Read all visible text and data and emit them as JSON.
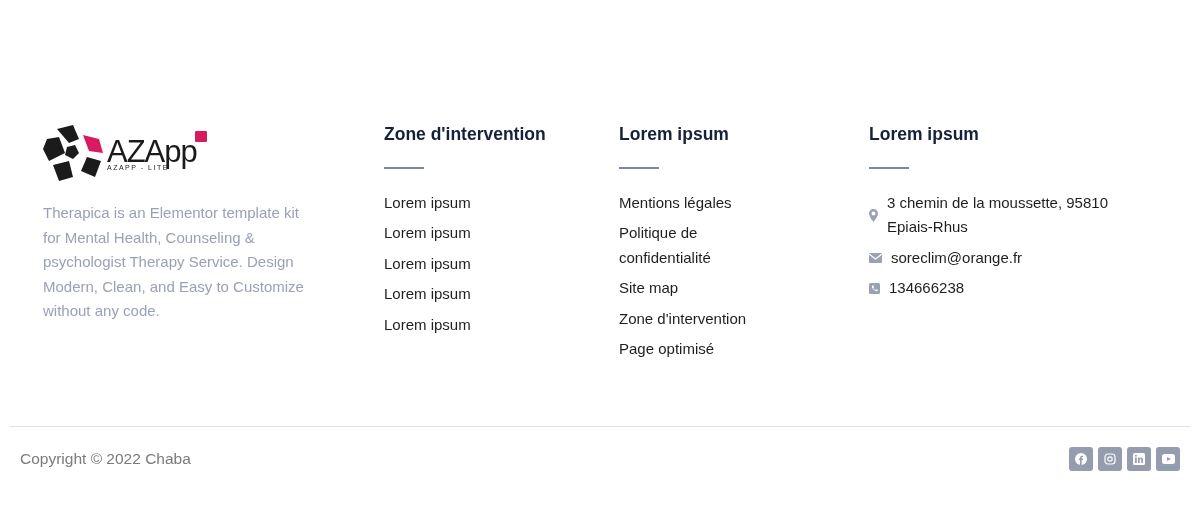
{
  "brand": {
    "logo_text": "AZApp",
    "logo_subtitle": "AZAPP - LITE",
    "description": "Therapica is an Elementor template kit for Mental Health, Counseling & psychologist Therapy Service. Design Modern, Clean, and Easy to Customize without any code."
  },
  "columns": [
    {
      "title": "Zone d'intervention",
      "links": [
        "Lorem ipsum",
        "Lorem ipsum",
        "Lorem ipsum",
        "Lorem ipsum",
        "Lorem ipsum"
      ]
    },
    {
      "title": "Lorem ipsum",
      "links": [
        "Mentions légales",
        "Politique de confidentialité",
        "Site map",
        "Zone d'intervention",
        "Page optimisé"
      ]
    }
  ],
  "contact": {
    "title": "Lorem ipsum",
    "items": [
      {
        "kind": "address",
        "text": "3 chemin de la moussette, 95810 Epiais-Rhus"
      },
      {
        "kind": "email",
        "text": "soreclim@orange.fr"
      },
      {
        "kind": "phone",
        "text": "134666238"
      }
    ]
  },
  "copyright": "Copyright © 2022 Chaba",
  "social": [
    {
      "kind": "facebook"
    },
    {
      "kind": "instagram"
    },
    {
      "kind": "linkedin"
    },
    {
      "kind": "youtube"
    }
  ]
}
